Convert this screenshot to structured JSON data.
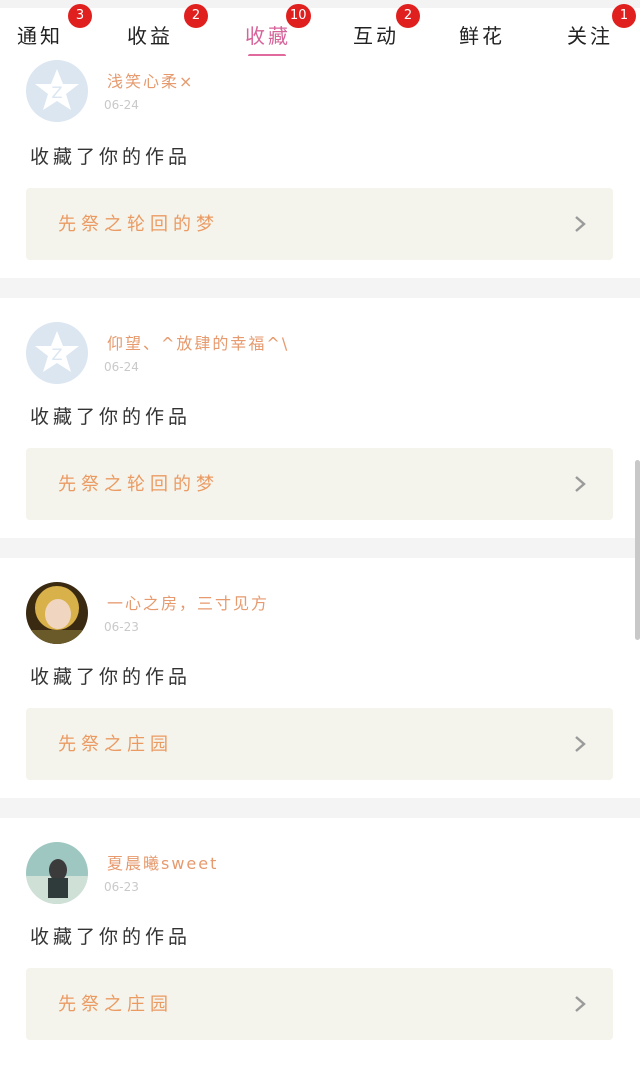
{
  "tabs": [
    {
      "label": "通知",
      "badge": "3"
    },
    {
      "label": "收益",
      "badge": "2"
    },
    {
      "label": "收藏",
      "badge": "10",
      "active": true
    },
    {
      "label": "互动",
      "badge": "2"
    },
    {
      "label": "鲜花",
      "badge": ""
    },
    {
      "label": "关注",
      "badge": "1"
    }
  ],
  "feed": [
    {
      "username": "浅笑心柔×",
      "date": "06-24",
      "action": "收藏了你的作品",
      "work": "先祭之轮回的梦",
      "avatar": "default-avatar-icon"
    },
    {
      "username": "仰望、^放肆的幸福^\\",
      "date": "06-24",
      "action": "收藏了你的作品",
      "work": "先祭之轮回的梦",
      "avatar": "default-avatar-icon"
    },
    {
      "username": "一心之房，三寸见方",
      "date": "06-23",
      "action": "收藏了你的作品",
      "work": "先祭之庄园",
      "avatar": "photo-avatar"
    },
    {
      "username": "夏晨曦sweet",
      "date": "06-23",
      "action": "收藏了你的作品",
      "work": "先祭之庄园",
      "avatar": "photo-avatar"
    }
  ],
  "colors": {
    "accent": "#e06a9d",
    "badge": "#e0201f",
    "username": "#e69a6e",
    "work_title": "#eb9a62",
    "work_bg": "#f4f4ec"
  }
}
